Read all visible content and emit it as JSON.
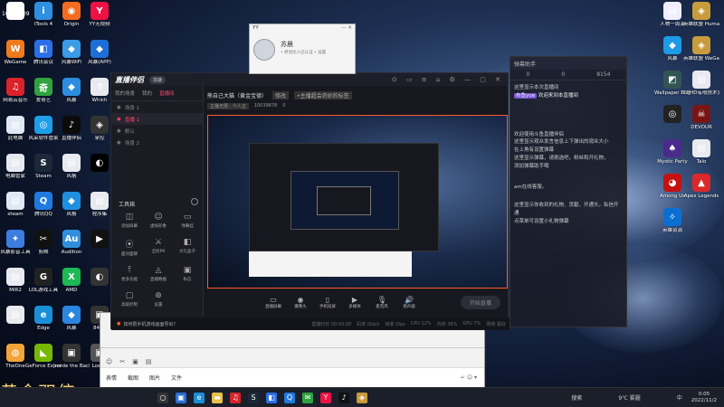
{
  "corner_label": "10069909",
  "desktop_left": [
    {
      "label": "",
      "color": "#ffffff",
      "glyph": "▦"
    },
    {
      "label": "iTools 4",
      "color": "#2f8fe0",
      "glyph": "i"
    },
    {
      "label": "Origin",
      "color": "#f46b1f",
      "glyph": "◉"
    },
    {
      "label": "YY无视频",
      "color": "#e14",
      "glyph": "Y"
    },
    {
      "label": "WeGame",
      "color": "#ef7a1c",
      "glyph": "W"
    },
    {
      "label": "腾讯会议",
      "color": "#2a6fe8",
      "glyph": "◧"
    },
    {
      "label": "风暴WiFi",
      "color": "#3a9be6",
      "glyph": "◆"
    },
    {
      "label": "风暴(APP)",
      "color": "#1d6fd8",
      "glyph": "◆"
    },
    {
      "label": "网易云音乐",
      "color": "#d9222a",
      "glyph": "♫"
    },
    {
      "label": "爱奇艺",
      "color": "#2fa33e",
      "glyph": "奇"
    },
    {
      "label": "风暴",
      "color": "#2c8de0",
      "glyph": "◆"
    },
    {
      "label": "Which",
      "color": "#e8eaf0",
      "glyph": "?"
    },
    {
      "label": "此电脑",
      "color": "#dfe8f5",
      "glyph": "▤"
    },
    {
      "label": "风采软件管家",
      "color": "#1f9ee8",
      "glyph": "◎"
    },
    {
      "label": "直播伴侣",
      "color": "#0b0b0b",
      "glyph": "♪"
    },
    {
      "label": "掌控",
      "color": "#333",
      "glyph": "◈"
    },
    {
      "label": "电脑管家",
      "color": "#e6e9ef",
      "glyph": "▤"
    },
    {
      "label": "Steam",
      "color": "#1b2838",
      "glyph": "S"
    },
    {
      "label": "风格",
      "color": "#e8eaf0",
      "glyph": "▤"
    },
    {
      "label": "",
      "color": "#000",
      "glyph": "◐"
    },
    {
      "label": "steam",
      "color": "#dfe8f5",
      "glyph": "▤"
    },
    {
      "label": "腾讯QQ",
      "color": "#1f7ae0",
      "glyph": "Q"
    },
    {
      "label": "风格",
      "color": "#1f90e0",
      "glyph": "◆"
    },
    {
      "label": "程序集",
      "color": "#e8eaf0",
      "glyph": "▤"
    },
    {
      "label": "风暴影音工具",
      "color": "#3c7de0",
      "glyph": "✦"
    },
    {
      "label": "剪映",
      "color": "#111",
      "glyph": "✂"
    },
    {
      "label": "Audition",
      "color": "#2f8fdc",
      "glyph": "Au"
    },
    {
      "label": "",
      "color": "#111",
      "glyph": "▶"
    },
    {
      "label": "MIR2",
      "color": "#e8eaf0",
      "glyph": "▤"
    },
    {
      "label": "LOL游戏工具",
      "color": "#222",
      "glyph": "G"
    },
    {
      "label": "AMD",
      "color": "#1db954",
      "glyph": "X"
    },
    {
      "label": "",
      "color": "#333",
      "glyph": "◐"
    },
    {
      "label": "",
      "color": "#e8eaf0",
      "glyph": "▤"
    },
    {
      "label": "Edge",
      "color": "#1a8fd8",
      "glyph": "e"
    },
    {
      "label": "风暴",
      "color": "#2b86df",
      "glyph": "◆"
    },
    {
      "label": "8471",
      "color": "#333",
      "glyph": "▣"
    },
    {
      "label": "TheOne",
      "color": "#f2a43a",
      "glyph": "◍"
    },
    {
      "label": "GeForce Experience",
      "color": "#76b900",
      "glyph": "◣"
    },
    {
      "label": "Inside the Backroom",
      "color": "#333",
      "glyph": "▣"
    },
    {
      "label": "Lost A",
      "color": "#555",
      "glyph": "▣"
    }
  ],
  "desktop_right": [
    {
      "label": "人物一周演",
      "color": "#eef",
      "glyph": "▤"
    },
    {
      "label": "英雄联盟 Human Fall",
      "color": "#c89b3c",
      "glyph": "◈"
    },
    {
      "label": "风暴",
      "color": "#1d9be6",
      "glyph": "◆"
    },
    {
      "label": "英雄联盟 WeGame版",
      "color": "#c89b3c",
      "glyph": "◈"
    },
    {
      "label": "Wallpaper Engine",
      "color": "#355",
      "glyph": "◩"
    },
    {
      "label": "CPHD有限技术支",
      "color": "#e8eaf0",
      "glyph": "▤"
    },
    {
      "label": "",
      "color": "#222",
      "glyph": "◎"
    },
    {
      "label": "DEVOUR",
      "color": "#7a1414",
      "glyph": "☠"
    },
    {
      "label": "Mystic Party",
      "color": "#4a2a8a",
      "glyph": "♠"
    },
    {
      "label": "Talo",
      "color": "#e8eaf0",
      "glyph": "▤"
    },
    {
      "label": "Among Us",
      "color": "#c51111",
      "glyph": "◕"
    },
    {
      "label": "Apex Legends",
      "color": "#da292a",
      "glyph": "▲"
    },
    {
      "label": "英雄资源",
      "color": "#0a6fd0",
      "glyph": "✧"
    }
  ],
  "yy_popup": {
    "title": "YY",
    "name": "苏晨",
    "status": "• 原创达人已认证 • 设置"
  },
  "main_app": {
    "title": "直播伴侣",
    "version": "加速",
    "tabs": [
      "我的场景",
      "我的",
      "直播间"
    ],
    "scenes": [
      {
        "name": "场景 1",
        "active": false
      },
      {
        "name": "直播 1",
        "active": true
      },
      {
        "name": "默认",
        "active": false
      },
      {
        "name": "场景 2",
        "active": false
      }
    ],
    "stream_title": "熊自己大猫（黄金宝德）",
    "stream_tag": "修改",
    "stream_desc": "•主播超会奇妙的标签",
    "host_info": "主播无限 · 个人主",
    "fans": "10039878",
    "likes": "0",
    "tools_header": "工具箱",
    "tools": [
      {
        "label": "添加屏幕",
        "glyph": "◫"
      },
      {
        "label": "虚拟形象",
        "glyph": "☺"
      },
      {
        "label": "弹幕挂",
        "glyph": "▭"
      },
      {
        "label": "面对面聊",
        "glyph": "⦿"
      },
      {
        "label": "全民PK",
        "glyph": "⚔"
      },
      {
        "label": "大礼盒子",
        "glyph": "◧"
      },
      {
        "label": "更多功能",
        "glyph": "⤒"
      },
      {
        "label": "直播数据",
        "glyph": "◬"
      },
      {
        "label": "私信",
        "glyph": "▣"
      },
      {
        "label": "高级控制",
        "glyph": "▢"
      },
      {
        "label": "设置",
        "glyph": "⊛"
      }
    ],
    "bottom_buttons": [
      {
        "label": "直播屏幕",
        "glyph": "▭"
      },
      {
        "label": "摄像头",
        "glyph": "◉"
      },
      {
        "label": "手机投屏",
        "glyph": "▯"
      },
      {
        "label": "多媒体",
        "glyph": "▶"
      },
      {
        "label": "麦克风",
        "glyph": "🎙"
      },
      {
        "label": "扬声器",
        "glyph": "🔊"
      }
    ],
    "start_button": "开始直播",
    "notice": "如何把手机游戏画面导出？",
    "status": [
      "直播时长 00:00:00",
      "码率 0kb/s",
      "帧率 0fps",
      "CPU 12%",
      "内存 36%",
      "GPU 7%",
      "网络 极好"
    ]
  },
  "chat": {
    "title": "弹幕助手",
    "stats": [
      "0",
      "0",
      "8154"
    ],
    "messages": [
      "这里显示本次直播间",
      "这里显示观众发言信息上下弹出的观众大小",
      "在上角有设置弹幕",
      "这里显示弹幕，请挑选吧，粉丝和开礼物，",
      "添加弹幕助手哦",
      "这里显示你收到的礼物、贡献、开通头，私信开通",
      "点菜单可设置小礼物弹幕"
    ],
    "highlight_name": "布鱼yue",
    "highlight_text": "欢迎来到本直播间",
    "welcome": "欢迎使用斗鱼直播伴侣",
    "extra": "am在线客服。"
  },
  "im_window": {
    "input_placeholder": "",
    "actions": [
      "表情",
      "截图",
      "图片",
      "文件"
    ]
  },
  "big_title": "黄金双倍",
  "taskbar": {
    "search": "搜索",
    "weather": "9℃ 雾霾",
    "lang": "中",
    "time": "0:05",
    "date": "2022/11/2"
  }
}
